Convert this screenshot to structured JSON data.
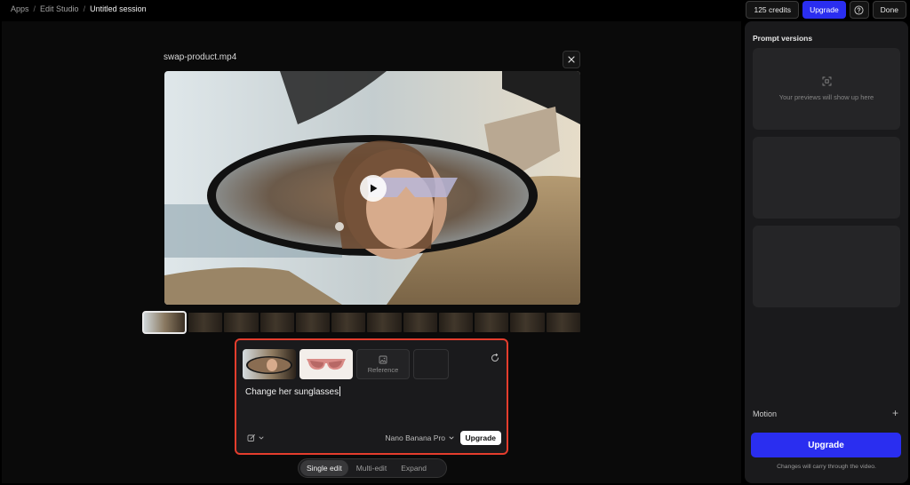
{
  "breadcrumb": {
    "items": [
      "Apps",
      "Edit Studio",
      "Untitled session"
    ],
    "separator": "/"
  },
  "toolbar": {
    "credits_label": "125 credits",
    "upgrade_label": "Upgrade",
    "help_icon": "question-circle-icon",
    "done_label": "Done"
  },
  "viewer": {
    "filename": "swap-product.mp4",
    "close_icon": "close-icon",
    "play_icon": "play-icon",
    "timeline_frame_count": 12
  },
  "prompt": {
    "reference_label": "Reference",
    "text": "Change her sunglasses",
    "model_label": "Nano Banana Pro",
    "upgrade_label": "Upgrade",
    "reset_icon": "reset-icon",
    "edit_icon": "edit-icon"
  },
  "modes": {
    "items": [
      "Single edit",
      "Multi-edit",
      "Expand"
    ],
    "active": "Single edit"
  },
  "panel": {
    "title": "Prompt versions",
    "preview_placeholder": "Your previews will show up here",
    "motion_label": "Motion",
    "motion_add": "+",
    "upgrade_label": "Upgrade",
    "note": "Changes will carry through the video."
  },
  "colors": {
    "accent_blue": "#2a2ef0",
    "highlight_red": "#e43d2d",
    "panel_bg": "#1a1a1c"
  }
}
